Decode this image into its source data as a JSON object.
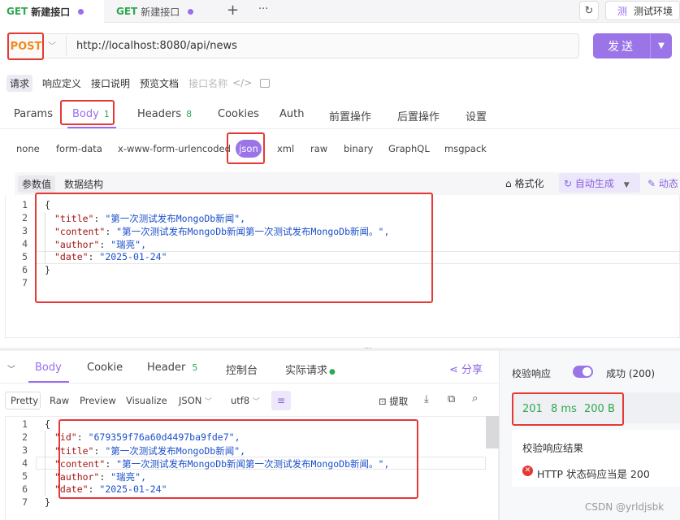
{
  "tabs": [
    {
      "method": "GET",
      "label": "新建接口"
    },
    {
      "method": "GET",
      "label": "新建接口"
    }
  ],
  "toolbar": {
    "plus": "+",
    "more": "···",
    "env_label": "测试环境",
    "env_icon": "测"
  },
  "request": {
    "method": "POST",
    "url": "http://localhost:8080/api/news",
    "send_label": "发送"
  },
  "sub_tabs": [
    "请求",
    "响应定义",
    "接口说明",
    "预览文档",
    "接口名称"
  ],
  "param_tabs": [
    {
      "label": "Params",
      "count": ""
    },
    {
      "label": "Body",
      "count": "1"
    },
    {
      "label": "Headers",
      "count": "8"
    },
    {
      "label": "Cookies",
      "count": ""
    },
    {
      "label": "Auth",
      "count": ""
    },
    {
      "label": "前置操作",
      "count": ""
    },
    {
      "label": "后置操作",
      "count": ""
    },
    {
      "label": "设置",
      "count": ""
    }
  ],
  "body_types": [
    "none",
    "form-data",
    "x-www-form-urlencoded",
    "json",
    "xml",
    "raw",
    "binary",
    "GraphQL",
    "msgpack"
  ],
  "editor": {
    "seg": [
      "参数值",
      "数据结构"
    ],
    "format_label": "格式化",
    "autogen_label": "自动生成",
    "dynamic_label": "动态",
    "lines": [
      {
        "n": "1",
        "text": "{"
      },
      {
        "n": "2",
        "key": "\"title\"",
        "val": "\"第一次测试发布MongoDb新闻\","
      },
      {
        "n": "3",
        "key": "\"content\"",
        "val": "\"第一次测试发布MongoDb新闻第一次测试发布MongoDb新闻。\","
      },
      {
        "n": "4",
        "key": "\"author\"",
        "val": "\"瑞亮\","
      },
      {
        "n": "5",
        "key": "\"date\"",
        "val": "\"2025-01-24\""
      },
      {
        "n": "6",
        "text": "}"
      },
      {
        "n": "7",
        "text": ""
      }
    ]
  },
  "response": {
    "tabs": [
      {
        "label": "Body",
        "count": ""
      },
      {
        "label": "Cookie",
        "count": ""
      },
      {
        "label": "Header",
        "count": "5"
      },
      {
        "label": "控制台",
        "count": ""
      },
      {
        "label": "实际请求",
        "count": ""
      }
    ],
    "share_label": "分享",
    "formats": [
      "Pretty",
      "Raw",
      "Preview",
      "Visualize",
      "JSON",
      "utf8"
    ],
    "extract_label": "提取",
    "lines": [
      {
        "n": "1",
        "text": "{"
      },
      {
        "n": "2",
        "key": "\"id\"",
        "val": "\"679359f76a60d4497ba9fde7\","
      },
      {
        "n": "3",
        "key": "\"title\"",
        "val": "\"第一次测试发布MongoDb新闻\","
      },
      {
        "n": "4",
        "key": "\"content\"",
        "val": "\"第一次测试发布MongoDb新闻第一次测试发布MongoDb新闻。\","
      },
      {
        "n": "5",
        "key": "\"author\"",
        "val": "\"瑞亮\","
      },
      {
        "n": "6",
        "key": "\"date\"",
        "val": "\"2025-01-24\""
      },
      {
        "n": "7",
        "text": "}"
      }
    ]
  },
  "validation": {
    "label": "校验响应",
    "status": "成功 (200)",
    "code": "201",
    "time": "8 ms",
    "size": "200 B",
    "result_title": "校验响应结果",
    "result_item": "HTTP 状态码应当是 200"
  },
  "watermark": "CSDN @yrldjsbk",
  "colors": {
    "accent": "#9b6cf0",
    "post": "#ef8a1b",
    "get": "#2fa84f",
    "highlight": "#e53935"
  }
}
